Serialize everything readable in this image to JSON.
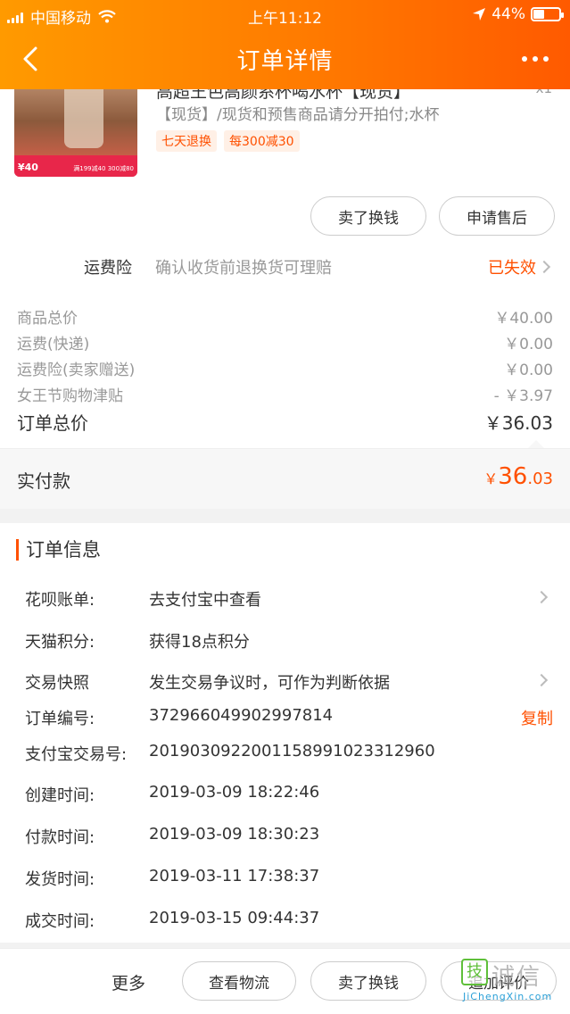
{
  "status_bar": {
    "carrier": "中国移动",
    "time": "上午11:12",
    "battery": "44%",
    "battery_level": 0.44
  },
  "nav": {
    "title": "订单详情"
  },
  "product": {
    "title": "高超王色高颜系杯喝水杯【现货】",
    "qty": "x1",
    "spec": "【现货】/现货和预售商品请分开拍付;水杯",
    "badges": [
      "七天退换",
      "每300减30"
    ],
    "thumb_price": "¥40",
    "thumb_promo": "满199减40 300减80"
  },
  "actions": {
    "sell_label": "卖了换钱",
    "after_sale_label": "申请售后"
  },
  "insurance": {
    "label": "运费险",
    "desc": "确认收货前退换货可理赔",
    "status": "已失效"
  },
  "prices": {
    "rows": [
      {
        "label": "商品总价",
        "value": "￥40.00"
      },
      {
        "label": "运费(快递)",
        "value": "￥0.00"
      },
      {
        "label": "运费险(卖家赠送)",
        "value": "￥0.00"
      },
      {
        "label": "女王节购物津贴",
        "value": "- ￥3.97"
      }
    ],
    "total_label": "订单总价",
    "total_value": "￥36.03"
  },
  "paid": {
    "label": "实付款",
    "currency": "￥",
    "int": "36",
    "dec": ".03"
  },
  "info": {
    "title": "订单信息",
    "rows": [
      {
        "key": "花呗账单:",
        "value": "去支付宝中查看"
      },
      {
        "key": "天猫积分:",
        "value": "获得18点积分"
      },
      {
        "key": "交易快照",
        "value": "发生交易争议时，可作为判断依据"
      },
      {
        "key": "订单编号:",
        "value": "372966049902997814",
        "action": "复制"
      },
      {
        "key": "支付宝交易号:",
        "value": "2019030922001158991023312960"
      },
      {
        "key": "创建时间:",
        "value": "2019-03-09 18:22:46"
      },
      {
        "key": "付款时间:",
        "value": "2019-03-09 18:30:23"
      },
      {
        "key": "发货时间:",
        "value": "2019-03-11 17:38:37"
      },
      {
        "key": "成交时间:",
        "value": "2019-03-15 09:44:37"
      }
    ]
  },
  "bottom": {
    "more": "更多",
    "logistics": "查看物流",
    "sell": "卖了换钱",
    "review": "追加评价"
  },
  "watermark": {
    "logo": "技",
    "text": "诚信",
    "url": "JiChengXin.com"
  }
}
